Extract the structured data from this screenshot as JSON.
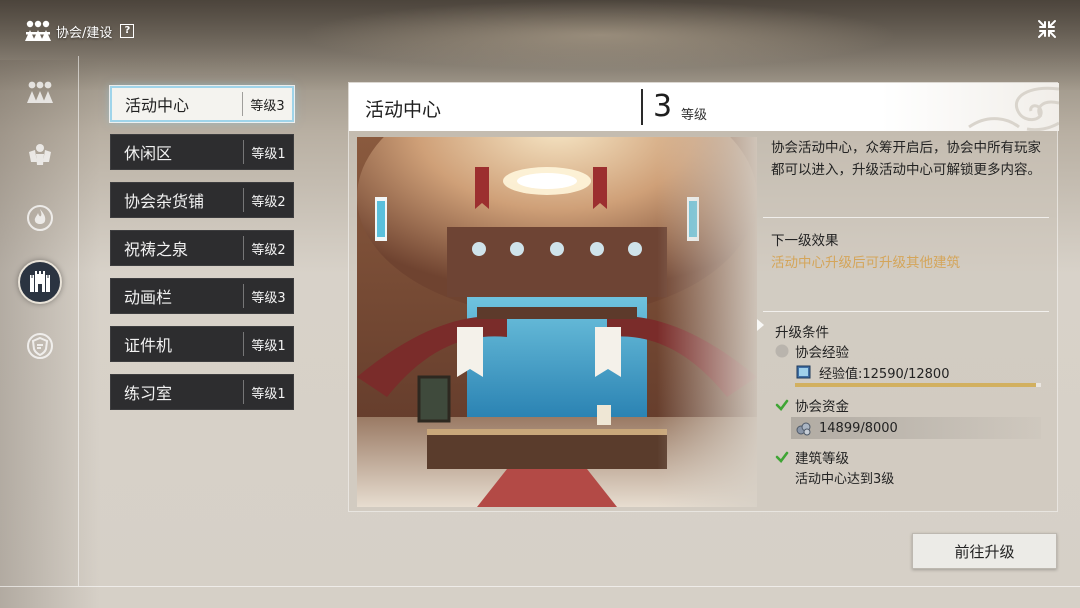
{
  "header": {
    "breadcrumb": "协会/建设",
    "help_icon": "?",
    "logo_icon": "association-logo-icon",
    "close_icon": "collapse-icon"
  },
  "rail": [
    {
      "icon": "members-icon",
      "active": false
    },
    {
      "icon": "crest-icon",
      "active": false
    },
    {
      "icon": "flame-icon",
      "active": false
    },
    {
      "icon": "castle-icon",
      "active": true
    },
    {
      "icon": "shield-icon",
      "active": false
    }
  ],
  "buildings": [
    {
      "name": "活动中心",
      "level": "等级3",
      "selected": true
    },
    {
      "name": "休闲区",
      "level": "等级1",
      "selected": false
    },
    {
      "name": "协会杂货铺",
      "level": "等级2",
      "selected": false
    },
    {
      "name": "祝祷之泉",
      "level": "等级2",
      "selected": false
    },
    {
      "name": "动画栏",
      "level": "等级3",
      "selected": false
    },
    {
      "name": "证件机",
      "level": "等级1",
      "selected": false
    },
    {
      "name": "练习室",
      "level": "等级1",
      "selected": false
    }
  ],
  "detail": {
    "title": "活动中心",
    "level_num": "3",
    "level_label": "等级",
    "description": "协会活动中心，众筹开启后，协会中所有玩家都可以进入，升级活动中心可解锁更多内容。",
    "next_effect_title": "下一级效果",
    "next_effect_value": "活动中心升级后可升级其他建筑",
    "conditions_title": "升级条件",
    "conditions": {
      "exp": {
        "label": "协会经验",
        "met": false,
        "value_text": "经验值:12590/12800",
        "progress": 0.98,
        "icon": "exp-book-icon"
      },
      "funds": {
        "label": "协会资金",
        "met": true,
        "value_text": "14899/8000",
        "icon": "funds-icon"
      },
      "level": {
        "label": "建筑等级",
        "met": true,
        "value_text": "活动中心达到3级"
      }
    }
  },
  "upgrade_button": "前往升级",
  "colors": {
    "accent_gold": "#d4a55a",
    "check_green": "#3fa535",
    "list_dark": "#2d2d2f",
    "selected_border": "#9fd4ea"
  }
}
